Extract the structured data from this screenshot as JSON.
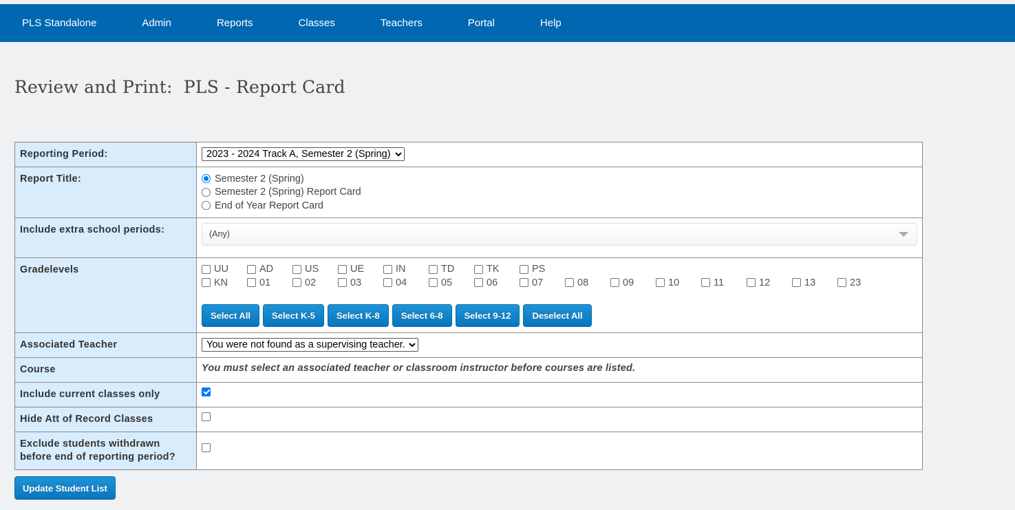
{
  "nav": {
    "items": [
      "PLS Standalone",
      "Admin",
      "Reports",
      "Classes",
      "Teachers",
      "Portal",
      "Help"
    ]
  },
  "page": {
    "title": "Review and Print:  PLS - Report Card"
  },
  "form": {
    "reporting_period": {
      "label": "Reporting Period:",
      "selected": "2023 - 2024 Track A, Semester 2 (Spring)"
    },
    "report_title": {
      "label": "Report Title:",
      "options": [
        {
          "label": "Semester 2 (Spring)",
          "checked": true
        },
        {
          "label": "Semester 2 (Spring) Report Card",
          "checked": false
        },
        {
          "label": "End of Year Report Card",
          "checked": false
        }
      ]
    },
    "extra_periods": {
      "label": "Include extra school periods:",
      "value": "(Any)"
    },
    "gradelevels": {
      "label": "Gradelevels",
      "row1": [
        "UU",
        "AD",
        "US",
        "UE",
        "IN",
        "TD",
        "TK",
        "PS"
      ],
      "row2": [
        "KN",
        "01",
        "02",
        "03",
        "04",
        "05",
        "06",
        "07",
        "08",
        "09",
        "10",
        "11",
        "12",
        "13",
        "23"
      ],
      "buttons": [
        "Select All",
        "Select K-5",
        "Select K-8",
        "Select 6-8",
        "Select 9-12",
        "Deselect All"
      ]
    },
    "associated_teacher": {
      "label": "Associated Teacher",
      "selected": "You were not found as a supervising teacher."
    },
    "course": {
      "label": "Course",
      "message": "You must select an associated teacher or classroom instructor before courses are listed."
    },
    "current_classes": {
      "label": "Include current classes only",
      "checked": true
    },
    "hide_att": {
      "label": "Hide Att of Record Classes",
      "checked": false
    },
    "exclude_withdrawn": {
      "label_line1": "Exclude students withdrawn",
      "label_line2": "before end of reporting period?",
      "checked": false
    }
  },
  "actions": {
    "update_label": "Update Student List"
  }
}
